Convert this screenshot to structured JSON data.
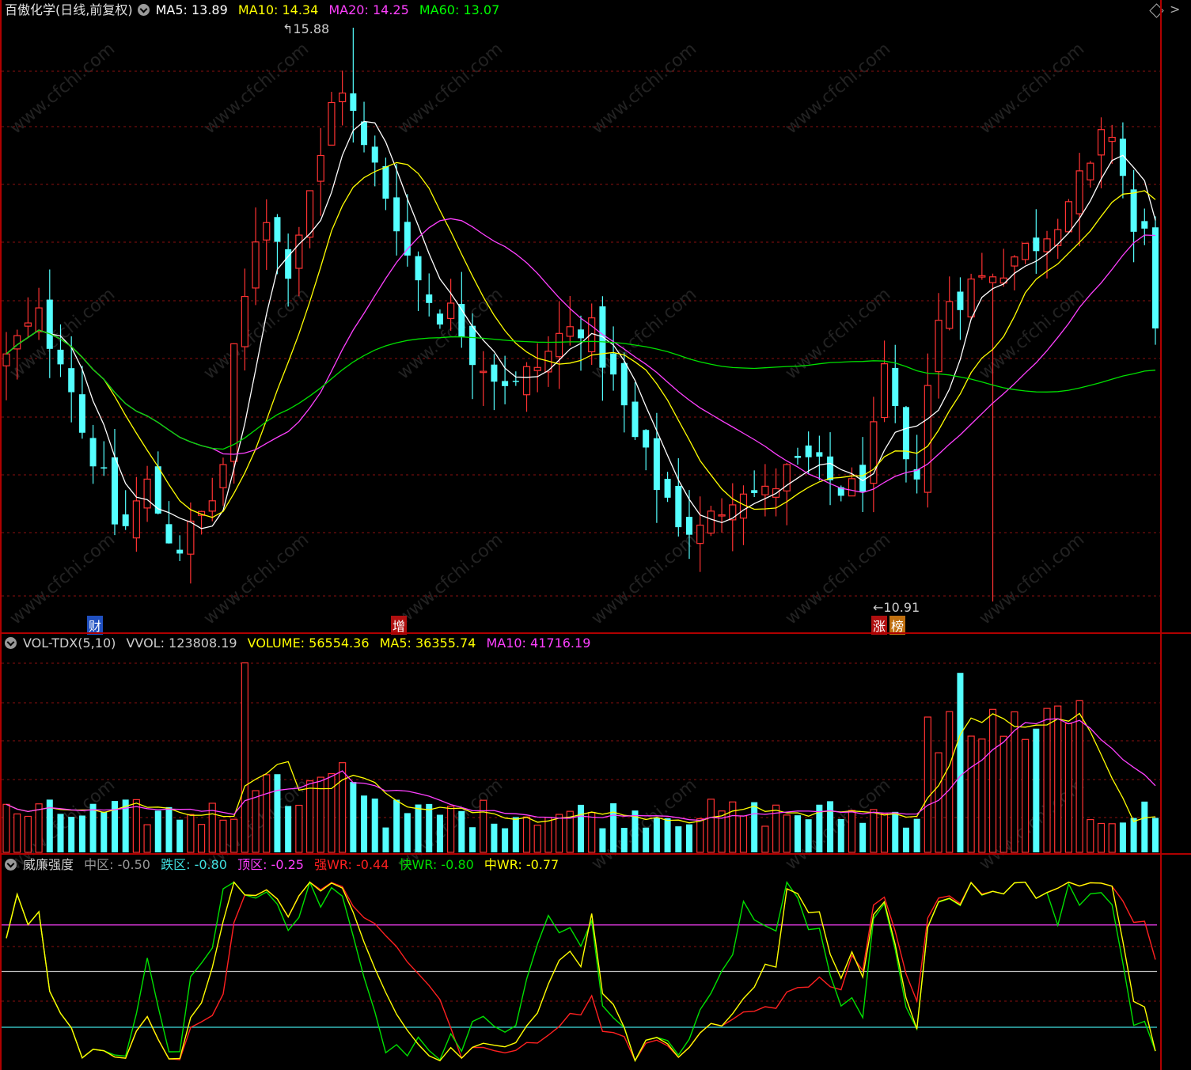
{
  "panel1": {
    "title": "百傲化学(日线,前复权)",
    "ma5": "MA5: 13.89",
    "ma10": "MA10: 14.34",
    "ma20": "MA20: 14.25",
    "ma60": "MA60: 13.07",
    "high_label": "15.88",
    "low_label": "10.91",
    "markers": [
      {
        "label": "财",
        "bg": "#2050c0"
      },
      {
        "label": "增",
        "bg": "#b01010"
      },
      {
        "label": "涨",
        "bg": "#b01010"
      },
      {
        "label": "榜",
        "bg": "#c07010"
      }
    ]
  },
  "panel2": {
    "name": "VOL-TDX(5,10)",
    "vvol": "VVOL: 123808.19",
    "volume": "VOLUME: 56554.36",
    "ma5": "MA5: 36355.74",
    "ma10": "MA10: 41716.19"
  },
  "panel3": {
    "name": "威廉强度",
    "mid": "中区: -0.50",
    "low": "跌区: -0.80",
    "top": "顶区: -0.25",
    "strong": "强WR: -0.44",
    "fast": "快WR: -0.80",
    "middle": "中WR: -0.77"
  },
  "colors": {
    "up": "#ff3232",
    "down": "#54ffff",
    "ma5": "#ffffff",
    "ma10": "#ffff00",
    "ma20": "#ff40ff",
    "ma60": "#00e000",
    "grid": "#8a1010"
  },
  "watermark": "www.cfchi.com",
  "chart_data": [
    {
      "type": "candlestick",
      "y_range": [
        10.91,
        15.88
      ],
      "series_names": [
        "MA5",
        "MA10",
        "MA20",
        "MA60"
      ],
      "price_path": [
        13.0,
        13.15,
        13.25,
        13.35,
        13.2,
        13.1,
        12.8,
        12.4,
        12.2,
        11.9,
        11.6,
        11.55,
        11.75,
        11.9,
        11.7,
        11.5,
        11.4,
        11.5,
        11.65,
        11.8,
        12.1,
        13.0,
        13.5,
        14.1,
        14.3,
        14.0,
        13.85,
        14.15,
        14.5,
        14.7,
        15.2,
        15.4,
        15.1,
        14.8,
        14.65,
        14.45,
        14.25,
        13.9,
        13.7,
        13.55,
        13.45,
        13.4,
        13.3,
        13.1,
        13.0,
        12.9,
        12.85,
        12.75,
        12.85,
        12.95,
        13.05,
        13.2,
        13.25,
        13.35,
        13.2,
        13.05,
        12.8,
        12.55,
        12.3,
        12.1,
        11.95,
        11.8,
        11.65,
        11.55,
        11.5,
        11.6,
        11.75,
        11.9,
        11.95,
        11.85,
        11.8,
        11.95,
        12.0,
        12.05,
        12.1,
        12.0,
        11.95,
        11.9,
        11.85,
        12.0,
        12.3,
        12.8,
        12.5,
        12.0,
        12.1,
        12.8,
        13.3,
        13.55,
        13.6,
        13.65,
        13.7,
        13.8,
        13.85,
        13.9,
        13.95,
        14.05,
        14.15,
        14.3,
        14.4,
        14.5,
        14.6,
        14.85,
        15.0,
        14.6,
        14.1,
        14.05,
        13.4
      ]
    },
    {
      "type": "bar",
      "series_names": [
        "VOLUME",
        "MA5",
        "MA10"
      ]
    },
    {
      "type": "line",
      "series_names": [
        "强WR",
        "快WR",
        "中WR"
      ],
      "y_range": [
        -1,
        0
      ],
      "reference_lines": [
        -0.25,
        -0.5,
        -0.8
      ]
    }
  ]
}
